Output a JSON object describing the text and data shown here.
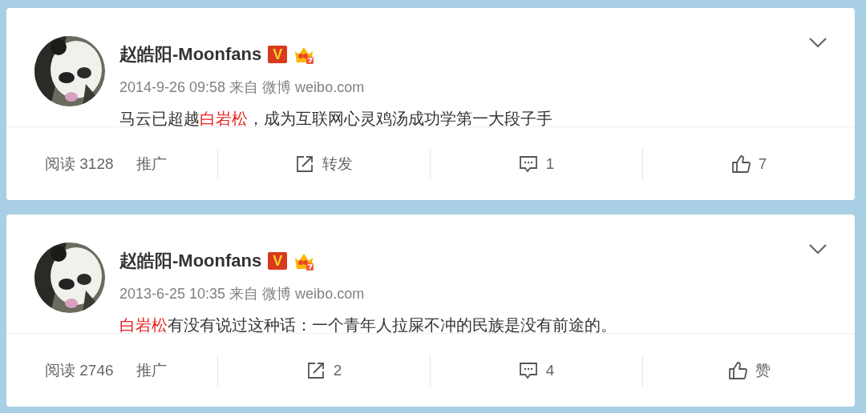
{
  "posts": [
    {
      "author": "赵皓阳-Moonfans",
      "verified_badge": "V",
      "meta": "2014-9-26 09:58 来自 微博 weibo.com",
      "content": [
        {
          "kind": "plain",
          "text": "马云已超越"
        },
        {
          "kind": "mention",
          "text": "白岩松"
        },
        {
          "kind": "plain",
          "text": "，成为互联网心灵鸡汤成功学第一大段子手"
        }
      ],
      "reads": "阅读 3128",
      "promote": "推广",
      "actions": [
        {
          "kind": "repost",
          "label": "转发"
        },
        {
          "kind": "comment",
          "label": "1"
        },
        {
          "kind": "like",
          "label": "7"
        }
      ]
    },
    {
      "author": "赵皓阳-Moonfans",
      "verified_badge": "V",
      "meta": "2013-6-25 10:35 来自 微博 weibo.com",
      "content": [
        {
          "kind": "mention",
          "text": "白岩松"
        },
        {
          "kind": "plain",
          "text": "有没有说过这种话：一个青年人拉屎不冲的民族是没有前途的。"
        }
      ],
      "reads": "阅读 2746",
      "promote": "推广",
      "actions": [
        {
          "kind": "repost",
          "label": "2"
        },
        {
          "kind": "comment",
          "label": "4"
        },
        {
          "kind": "like",
          "label": "赞"
        }
      ]
    }
  ]
}
